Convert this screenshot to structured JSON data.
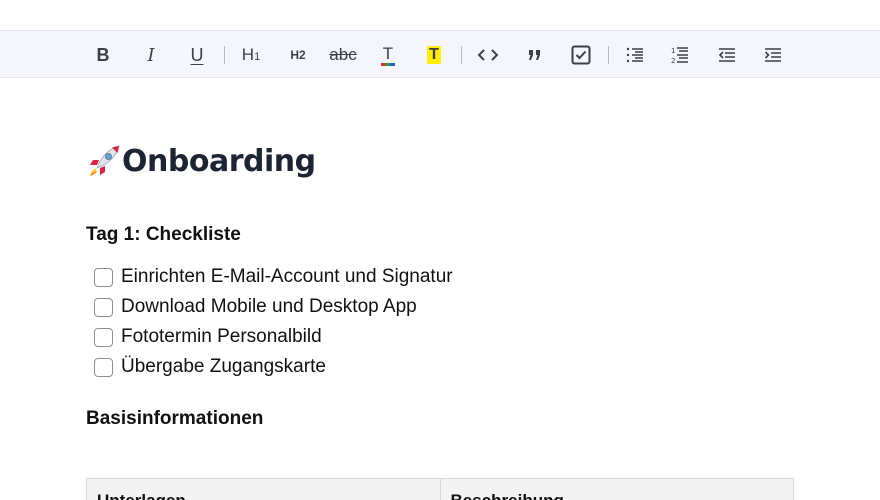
{
  "toolbar": {
    "bold_label": "B",
    "italic_label": "I",
    "underline_label": "U",
    "h1_label": "H",
    "h1_sub": "1",
    "h2_label": "H2",
    "strike_label": "abc",
    "textcolor_label": "T",
    "highlight_label": "T",
    "textcolor_accent": "#e0312a",
    "highlight_color": "#ffee00"
  },
  "document": {
    "title": "Onboarding",
    "section1_heading": "Tag 1: Checkliste",
    "checklist": [
      "Einrichten E-Mail-Account und Signatur",
      "Download Mobile und Desktop App",
      "Fototermin Personalbild",
      "Übergabe Zugangskarte"
    ],
    "section2_heading": "Basisinformationen",
    "table_headers": [
      "Unterlagen",
      "Beschreibung"
    ]
  }
}
